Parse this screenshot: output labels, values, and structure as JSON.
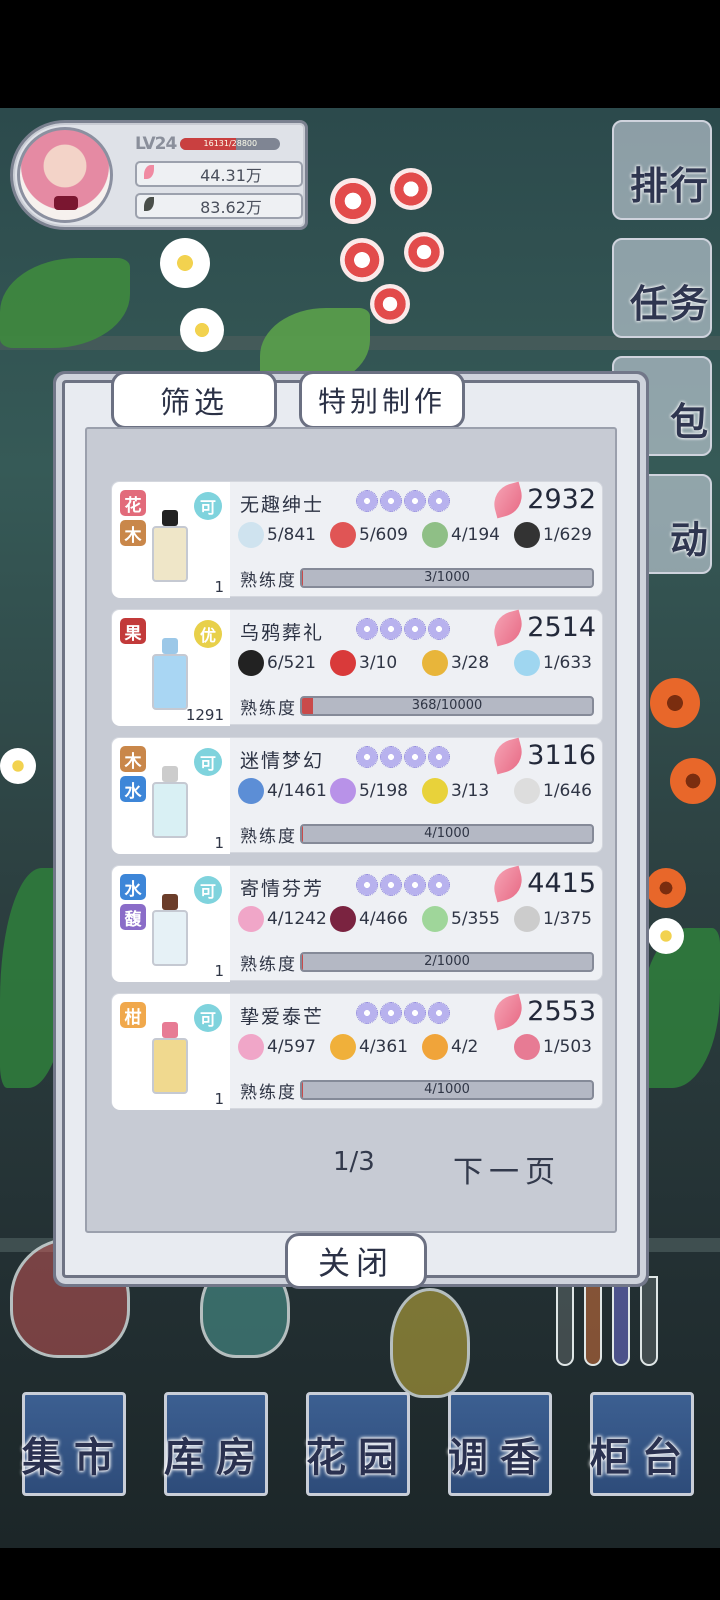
{
  "player": {
    "level": "LV24",
    "exp_text": "16131/28800",
    "exp_fraction": 0.56,
    "currency_petals": "44.31万",
    "currency_leaves": "83.62万"
  },
  "side_nav": {
    "ranking": "排行",
    "tasks": "任务",
    "bag": "包",
    "events": "动"
  },
  "dialog": {
    "tab_filter": "筛选",
    "tab_special": "特别制作",
    "proficiency_label": "熟练度",
    "page": "1/3",
    "next_page": "下一页",
    "close": "关闭"
  },
  "recipes": [
    {
      "name": "无趣绅士",
      "tags": [
        "花",
        "木"
      ],
      "grade": "可",
      "qty": "1",
      "price": "2932",
      "ingredients": [
        "5/841",
        "5/609",
        "4/194",
        "1/629"
      ],
      "proficiency": "3/1000",
      "proficiency_fraction": 0.003
    },
    {
      "name": "乌鸦葬礼",
      "tags": [
        "果"
      ],
      "grade": "优",
      "qty": "1291",
      "price": "2514",
      "ingredients": [
        "6/521",
        "3/10",
        "3/28",
        "1/633"
      ],
      "proficiency": "368/10000",
      "proficiency_fraction": 0.0368
    },
    {
      "name": "迷情梦幻",
      "tags": [
        "木",
        "水"
      ],
      "grade": "可",
      "qty": "1",
      "price": "3116",
      "ingredients": [
        "4/1461",
        "5/198",
        "3/13",
        "1/646"
      ],
      "proficiency": "4/1000",
      "proficiency_fraction": 0.004
    },
    {
      "name": "寄情芬芳",
      "tags": [
        "水",
        "馥"
      ],
      "grade": "可",
      "qty": "1",
      "price": "4415",
      "ingredients": [
        "4/1242",
        "4/466",
        "5/355",
        "1/375"
      ],
      "proficiency": "2/1000",
      "proficiency_fraction": 0.002
    },
    {
      "name": "挚爱泰芒",
      "tags": [
        "柑"
      ],
      "grade": "可",
      "qty": "1",
      "price": "2553",
      "ingredients": [
        "4/597",
        "4/361",
        "4/2",
        "1/503"
      ],
      "proficiency": "4/1000",
      "proficiency_fraction": 0.004
    }
  ],
  "bottom_nav": {
    "market": "集市",
    "warehouse": "库房",
    "garden": "花园",
    "blend": "调香",
    "counter": "柜台"
  }
}
